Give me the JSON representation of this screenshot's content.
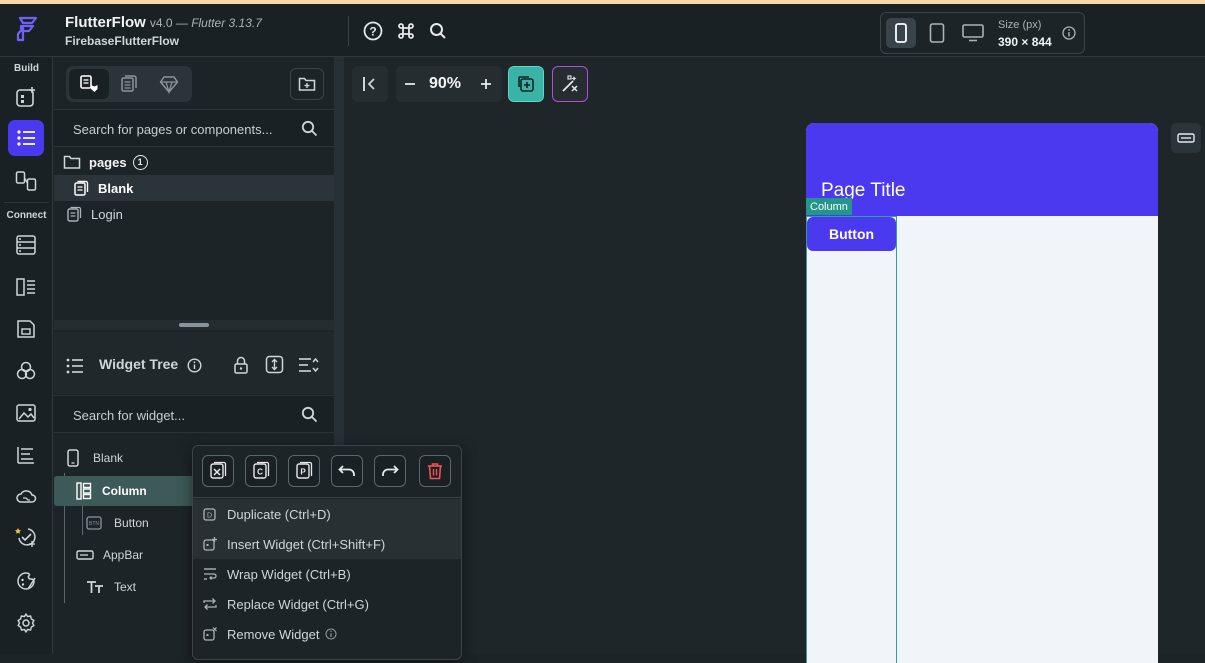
{
  "header": {
    "app_name": "FlutterFlow",
    "version_prefix": "v4.0 — ",
    "flutter_version": "Flutter 3.13.7",
    "project_name": "FirebaseFlutterFlow",
    "device": {
      "size_label": "Size (px)",
      "size_value": "390 × 844"
    }
  },
  "rail": {
    "build_label": "Build",
    "connect_label": "Connect"
  },
  "pages_panel": {
    "search_placeholder": "Search for pages or components...",
    "folder_label": "pages",
    "folder_count": "1",
    "pages": [
      {
        "label": "Blank",
        "selected": true
      },
      {
        "label": "Login",
        "selected": false
      }
    ]
  },
  "widget_tree": {
    "title": "Widget Tree",
    "search_placeholder": "Search for widget...",
    "nodes": [
      {
        "label": "Blank"
      },
      {
        "label": "Column"
      },
      {
        "label": "Button"
      },
      {
        "label": "AppBar"
      },
      {
        "label": "Text"
      }
    ]
  },
  "canvas": {
    "zoom": "90%",
    "page_title": "Page Title",
    "column_tag": "Column",
    "button_label": "Button",
    "colors": {
      "primary": "#4b39ef",
      "selection": "#2aa39a",
      "background": "#f1f4f8"
    }
  },
  "context_menu": {
    "items": [
      {
        "label": "Duplicate (Ctrl+D)"
      },
      {
        "label": "Insert Widget (Ctrl+Shift+F)"
      },
      {
        "label": "Wrap Widget (Ctrl+B)"
      },
      {
        "label": "Replace Widget (Ctrl+G)"
      },
      {
        "label": "Remove Widget"
      }
    ]
  }
}
